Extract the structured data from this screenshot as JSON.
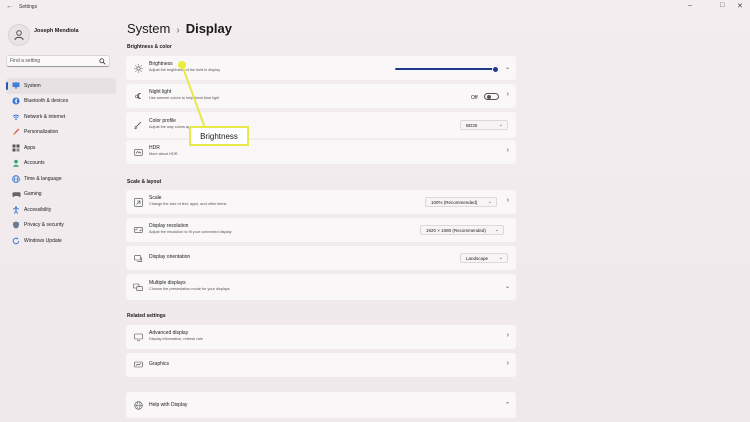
{
  "window": {
    "title": "Settings",
    "back_icon": "arrow-left-icon"
  },
  "profile": {
    "name": "Joseph Mendiola"
  },
  "search": {
    "placeholder": "Find a setting"
  },
  "nav": [
    {
      "label": "System",
      "icon": "monitor-icon",
      "active": true
    },
    {
      "label": "Bluetooth & devices",
      "icon": "bluetooth-icon"
    },
    {
      "label": "Network & internet",
      "icon": "wifi-icon"
    },
    {
      "label": "Personalization",
      "icon": "brush-icon"
    },
    {
      "label": "Apps",
      "icon": "apps-icon"
    },
    {
      "label": "Accounts",
      "icon": "person-icon"
    },
    {
      "label": "Time & language",
      "icon": "globe-icon"
    },
    {
      "label": "Gaming",
      "icon": "controller-icon"
    },
    {
      "label": "Accessibility",
      "icon": "accessibility-icon"
    },
    {
      "label": "Privacy & security",
      "icon": "shield-icon"
    },
    {
      "label": "Windows Update",
      "icon": "update-icon"
    }
  ],
  "breadcrumb": {
    "parent": "System",
    "current": "Display"
  },
  "sections": {
    "brightness_color": "Brightness & color",
    "scale_layout": "Scale & layout",
    "related": "Related settings"
  },
  "cards": {
    "brightness": {
      "title": "Brightness",
      "subtitle": "Adjust the brightness of the built-in display",
      "level": 1.0
    },
    "night_light": {
      "title": "Night light",
      "subtitle": "Use warmer colors to help block blue light",
      "state": "Off"
    },
    "color_profile": {
      "title": "Color profile",
      "subtitle": "Adjust the way colors appear on your screen",
      "value": "BD30"
    },
    "hdr": {
      "title": "HDR",
      "subtitle": "More about HDR"
    },
    "scale": {
      "title": "Scale",
      "subtitle": "Change the size of text, apps, and other items",
      "value": "100% (Recommended)"
    },
    "resolution": {
      "title": "Display resolution",
      "subtitle": "Adjust the resolution to fit your connected display",
      "value": "1920 × 1080 (Recommended)"
    },
    "orientation": {
      "title": "Display orientation",
      "value": "Landscape"
    },
    "multiple": {
      "title": "Multiple displays",
      "subtitle": "Choose the presentation mode for your displays"
    },
    "advanced": {
      "title": "Advanced display",
      "subtitle": "Display information, refresh rate"
    },
    "graphics": {
      "title": "Graphics"
    },
    "help": {
      "title": "Help with Display"
    }
  },
  "callout": {
    "label": "Brightness",
    "color": "#e8e84a"
  }
}
